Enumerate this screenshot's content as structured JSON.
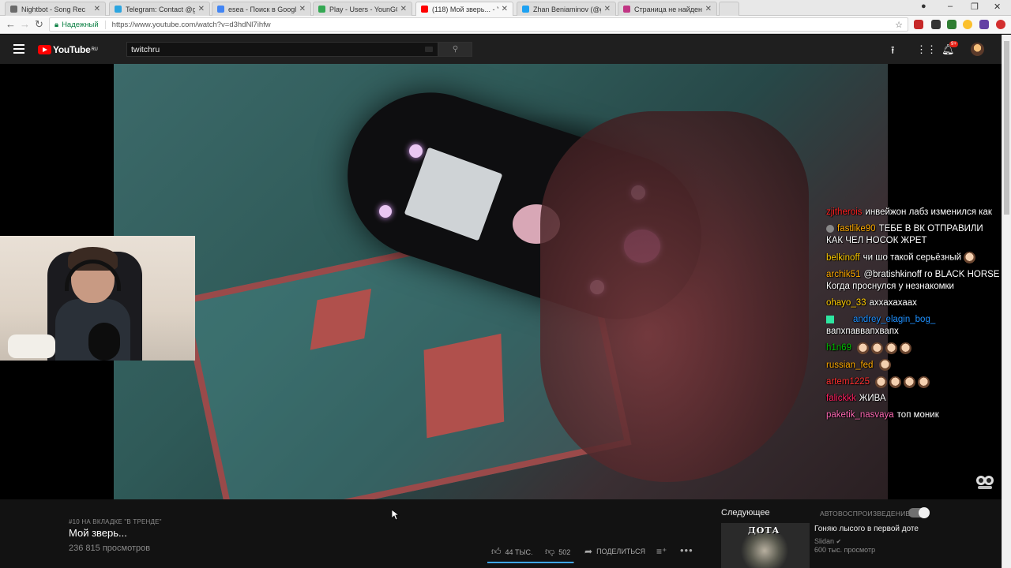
{
  "browser": {
    "tabs": [
      {
        "title": "Nightbot - Song Rec",
        "fav_color": "#6a6a6a"
      },
      {
        "title": "Telegram: Contact @gu",
        "fav_color": "#2ca5e0"
      },
      {
        "title": "esea - Поиск в Google",
        "fav_color": "#4285f4"
      },
      {
        "title": "Play - Users - YounGQ",
        "fav_color": "#34a853"
      },
      {
        "title": "(118) Мой зверь... - Y",
        "fav_color": "#ff0000"
      },
      {
        "title": "Zhan Beniaminov (@gu",
        "fav_color": "#1da1f2"
      },
      {
        "title": "Страница не найдена -",
        "fav_color": "#c13584"
      }
    ],
    "secure_label": "Надежный",
    "url": "https://www.youtube.com/watch?v=d3hdNl7ihfw"
  },
  "youtube": {
    "logo_text": "YouTube",
    "region": "RU",
    "search_value": "twitchru",
    "notification_count": "9+"
  },
  "chat": [
    {
      "nick": "zjitherois",
      "color": "#ff2020",
      "text": "инвейжон лабз изменился как"
    },
    {
      "nick": "fastlike90",
      "color": "#ffaa00",
      "text": "ТЕБЕ В ВК ОТПРАВИЛИ КАК ЧЕЛ НОСОК ЖРЕТ"
    },
    {
      "nick": "belkinoff",
      "color": "#ffcc00",
      "text": "чи шо такой серьёзный"
    },
    {
      "nick": "archik51",
      "color": "#ffaa00",
      "text": "@bratishkinoff го BLACK HORSE Когда проснулся у незнакомки"
    },
    {
      "nick": "ohayo_33",
      "color": "#ffcc00",
      "text": "аххахахаах"
    },
    {
      "nick": "andrey_elagin_bog_",
      "color": "#1e90ff",
      "text": "вапхпаввапхвапх"
    },
    {
      "nick": "h1n69",
      "color": "#00c000",
      "text": ""
    },
    {
      "nick": "russian_fed",
      "color": "#ffaa00",
      "text": ""
    },
    {
      "nick": "artem1225",
      "color": "#ff3030",
      "text": ""
    },
    {
      "nick": "falickkk",
      "color": "#ff2060",
      "text": "ЖИВА"
    },
    {
      "nick": "paketik_nasvaya",
      "color": "#ff69b4",
      "text": "топ моник"
    }
  ],
  "video": {
    "trending": "#10 НА ВКЛАДКЕ \"В ТРЕНДЕ\"",
    "title": "Мой зверь...",
    "views": "236 815 просмотров",
    "likes": "44 ТЫС.",
    "dislikes": "502",
    "share_label": "ПОДЕЛИТЬСЯ",
    "like_ratio": 0.99
  },
  "sidebar": {
    "up_next": "Следующее",
    "autoplay_label": "АВТОВОСПРОИЗВЕДЕНИЕ",
    "autoplay_on": true,
    "rec": {
      "thumb_text": "ДОТА",
      "title": "Гоняю лысого в первой доте",
      "channel": "Slidan",
      "views": "600 тыс. просмотр"
    }
  }
}
